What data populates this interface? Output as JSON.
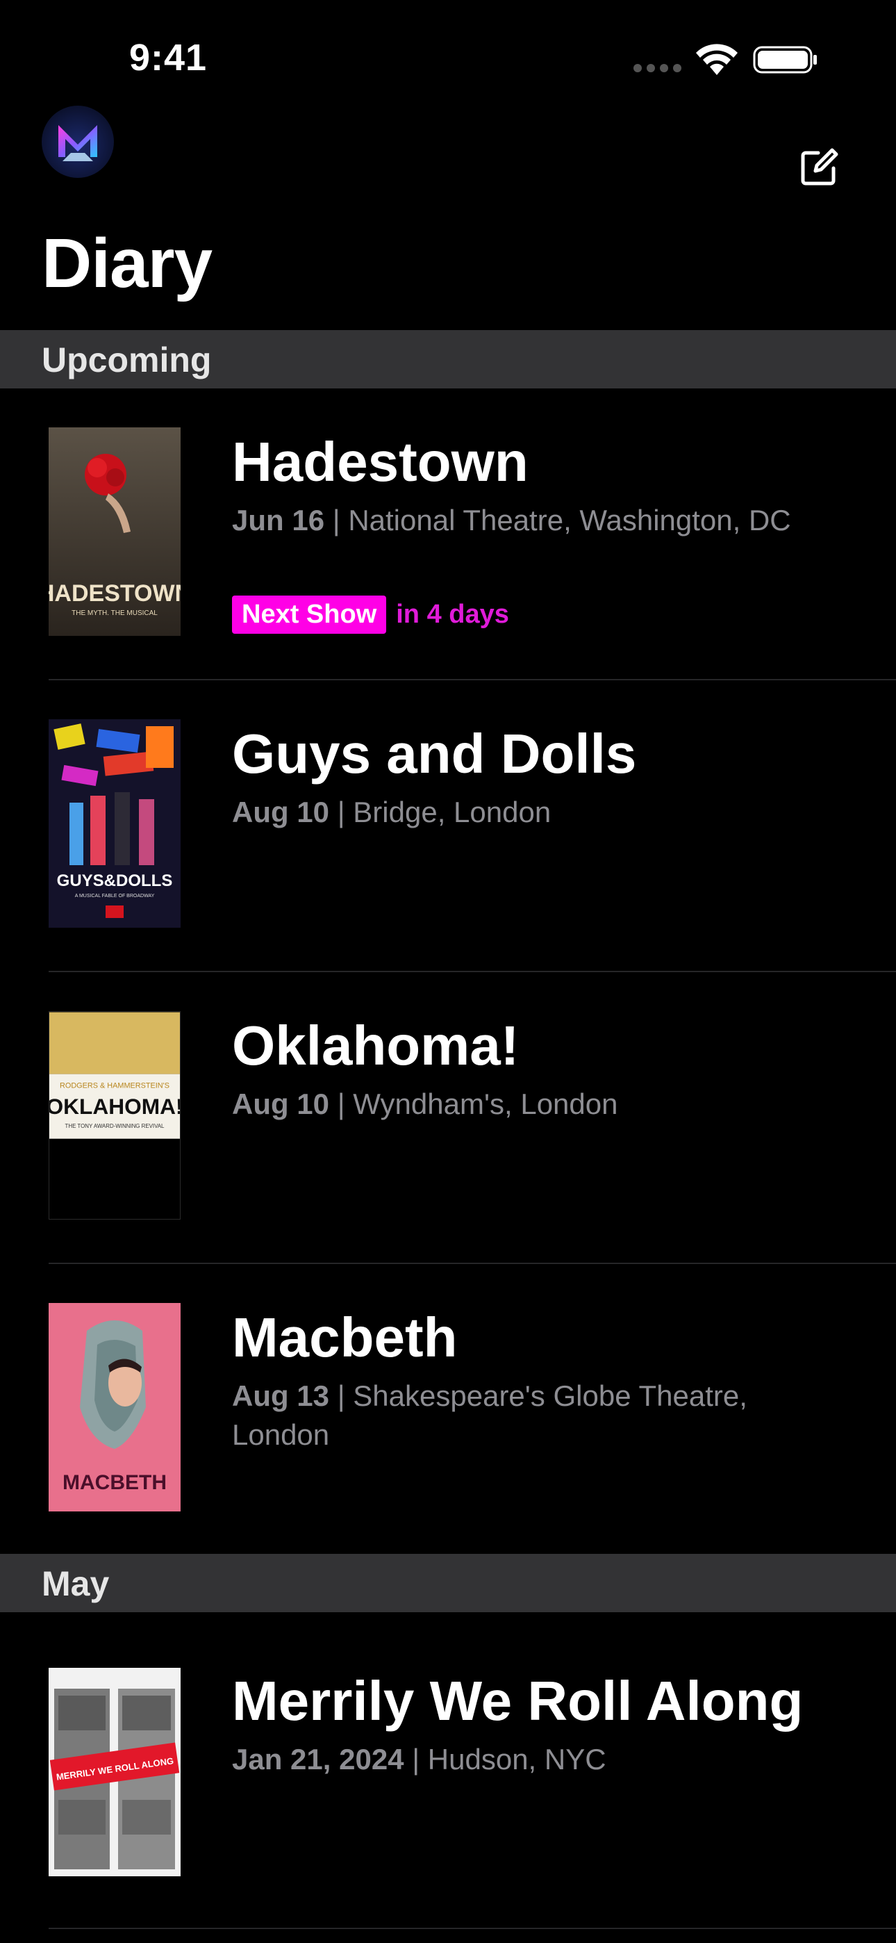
{
  "status_bar": {
    "time": "9:41"
  },
  "header": {
    "title": "Diary"
  },
  "sections": [
    {
      "name": "Upcoming"
    },
    {
      "name": "May"
    }
  ],
  "shows": [
    {
      "title": "Hadestown",
      "date": "Jun 16",
      "venue": "National Theatre, Washington, DC",
      "badge": "Next Show",
      "countdown": "in 4 days",
      "poster_text": "HADESTOWN",
      "poster_sub": "THE MYTH. THE MUSICAL"
    },
    {
      "title": "Guys and Dolls",
      "date": "Aug 10",
      "venue": "Bridge, London",
      "poster_text": "GUYS&DOLLS",
      "poster_sub": "A MUSICAL FABLE OF BROADWAY"
    },
    {
      "title": "Oklahoma!",
      "date": "Aug 10",
      "venue": "Wyndham's, London",
      "poster_text": "OKLAHOMA!",
      "poster_top": "RODGERS & HAMMERSTEIN'S",
      "poster_sub": "THE TONY AWARD-WINNING REVIVAL"
    },
    {
      "title": "Macbeth",
      "date": "Aug 13",
      "venue": "Shakespeare's Globe Theatre, London",
      "poster_text": "MACBETH"
    },
    {
      "title": "Merrily We Roll Along",
      "date": "Jan 21, 2024",
      "venue": "Hudson, NYC",
      "poster_text": "MERRILY WE ROLL ALONG"
    }
  ],
  "colors": {
    "background": "#000000",
    "section_bg": "#333335",
    "accent": "#ff00e6",
    "secondary_text": "#8e8e93"
  },
  "icons": {
    "logo": "app-logo-icon",
    "compose": "compose-icon",
    "wifi": "wifi-icon",
    "battery": "battery-icon"
  }
}
